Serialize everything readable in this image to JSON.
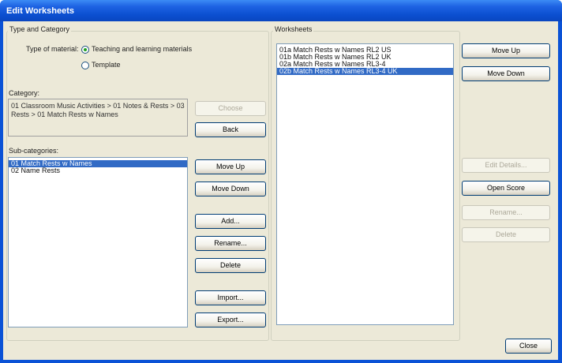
{
  "window": {
    "title": "Edit Worksheets"
  },
  "type_and_category": {
    "group_label": "Type and Category",
    "type_label": "Type of material:",
    "options": [
      {
        "label": "Teaching and learning materials",
        "checked": true
      },
      {
        "label": "Template",
        "checked": false
      }
    ],
    "category_label": "Category:",
    "category_path": "01 Classroom Music Activities > 01 Notes & Rests > 03 Rests > 01 Match Rests w Names",
    "subcategories_label": "Sub-categories:",
    "subcategories": [
      {
        "label": "01 Match Rests w Names",
        "selected": true
      },
      {
        "label": "02 Name Rests",
        "selected": false
      }
    ]
  },
  "middle_buttons": {
    "choose": "Choose",
    "back": "Back",
    "move_up": "Move Up",
    "move_down": "Move Down",
    "add": "Add...",
    "rename": "Rename...",
    "delete": "Delete",
    "import": "Import...",
    "export": "Export..."
  },
  "worksheets": {
    "group_label": "Worksheets",
    "items": [
      {
        "label": "01a Match Rests w Names RL2 US",
        "selected": false
      },
      {
        "label": "01b Match Rests w Names RL2 UK",
        "selected": false
      },
      {
        "label": "02a Match Rests w Names RL3-4",
        "selected": false
      },
      {
        "label": "02b Match Rests w Names RL3-4 UK",
        "selected": true
      }
    ]
  },
  "right_buttons": {
    "move_up": "Move Up",
    "move_down": "Move Down",
    "edit_details": "Edit Details...",
    "open_score": "Open Score",
    "rename": "Rename...",
    "delete": "Delete"
  },
  "footer": {
    "close": "Close"
  },
  "colors": {
    "title_bar": "#0a52d6",
    "selection": "#316ac5",
    "dialog_bg": "#ece9d8"
  }
}
